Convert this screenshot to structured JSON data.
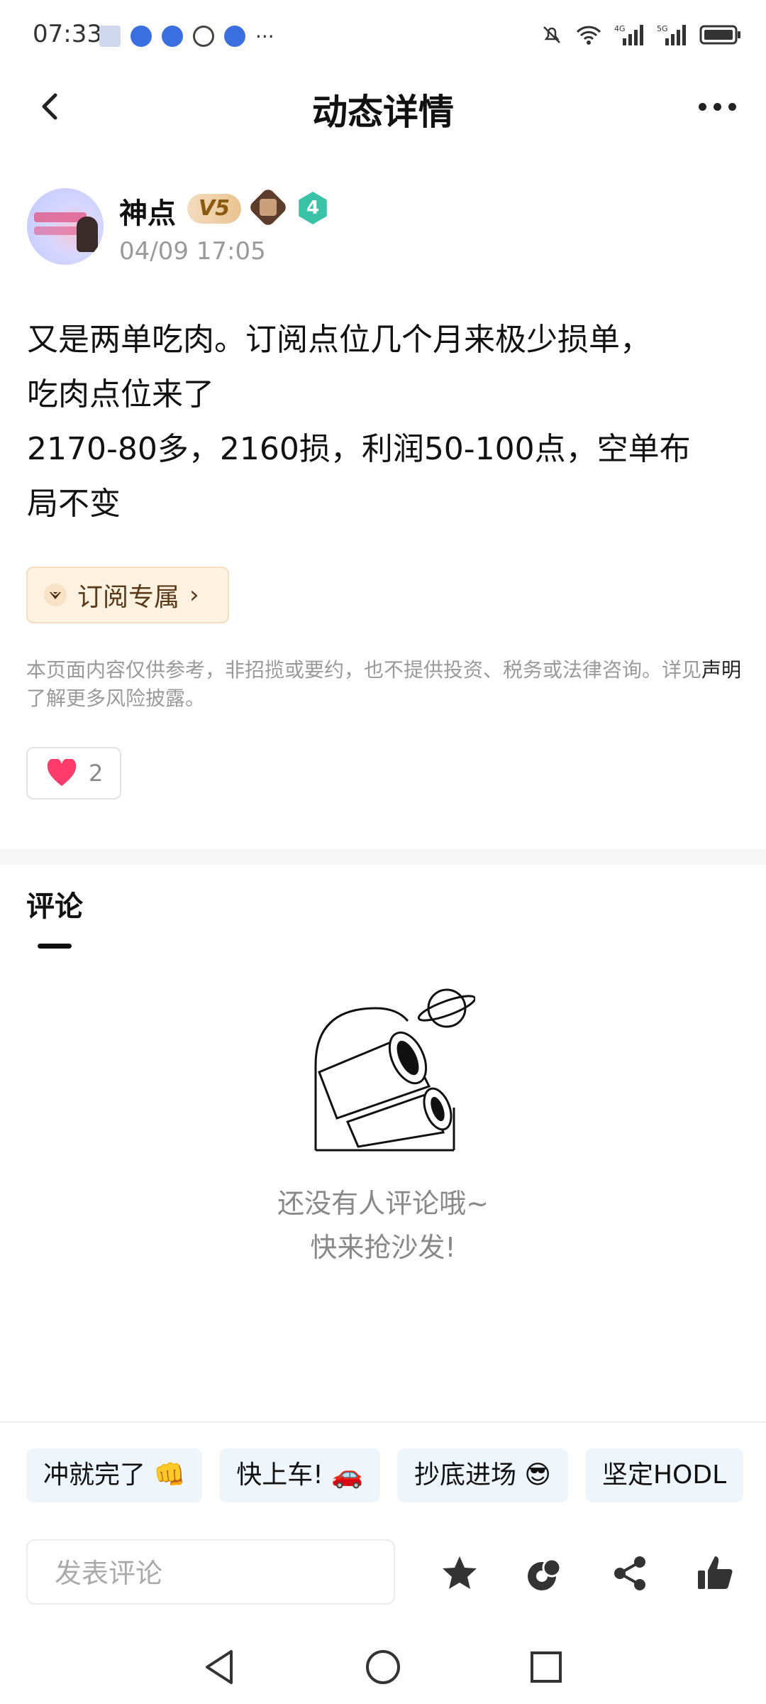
{
  "status_bar": {
    "time": "07:33",
    "more": "···"
  },
  "header": {
    "title": "动态详情"
  },
  "author": {
    "name": "神点",
    "vip_badge": "V5",
    "level_badge": "4",
    "time": "04/09 17:05"
  },
  "post": {
    "content": "又是两单吃肉。订阅点位几个月来极少损单，\n吃肉点位来了\n2170-80多，2160损，利润50-100点，空单布\n局不变",
    "subscribe_label": "订阅专属",
    "disclaimer_pre": "本页面内容仅供参考，非招揽或要约，也不提供投资、税务或法律咨询。详见",
    "disclaimer_link": "声明",
    "disclaimer_post": "了解更多风险披露。",
    "like_count": "2"
  },
  "comments": {
    "title": "评论",
    "empty_line1": "还没有人评论哦~",
    "empty_line2": "快来抢沙发!"
  },
  "quick_replies": [
    "冲就完了 👊",
    "快上车! 🚗",
    "抄底进场 😎",
    "坚定HODL"
  ],
  "bottom_bar": {
    "input_placeholder": "发表评论"
  },
  "colors": {
    "accent_like": "#ff3b6b",
    "subscribe_bg": "#fdf1e0",
    "quick_reply_bg": "#eef6fb"
  }
}
